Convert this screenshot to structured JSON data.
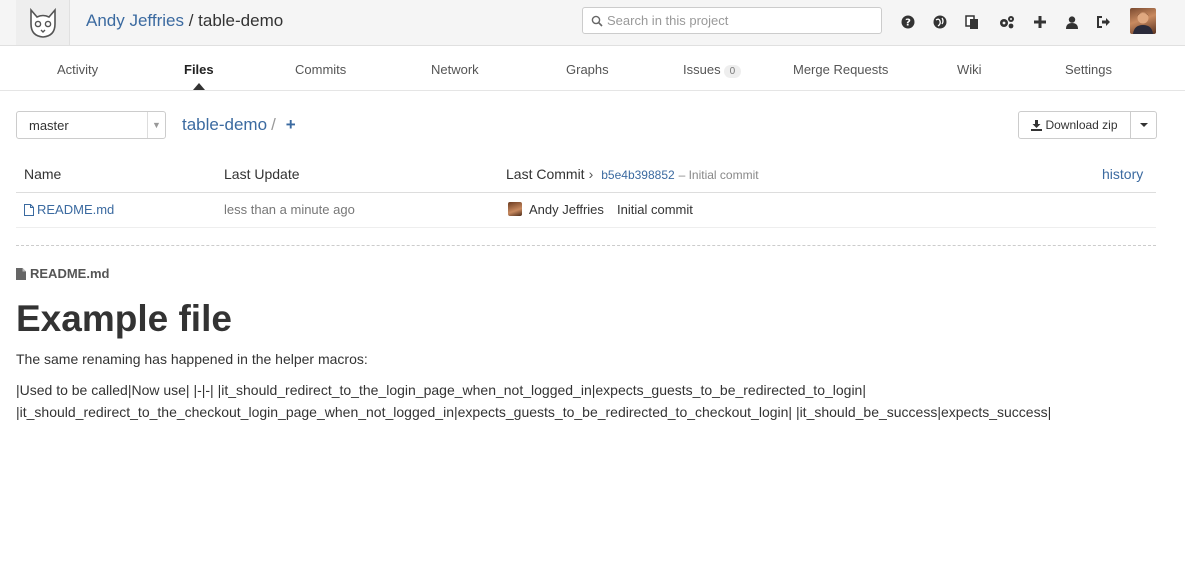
{
  "header": {
    "owner": "Andy Jeffries",
    "separator": " / ",
    "project": "table-demo",
    "search_placeholder": "Search in this project",
    "icons": [
      "help-icon",
      "globe-icon",
      "snippets-icon",
      "admin-gear-icon",
      "new-project-icon",
      "profile-icon",
      "logout-icon"
    ]
  },
  "nav": {
    "tabs": [
      {
        "label": "Activity"
      },
      {
        "label": "Files"
      },
      {
        "label": "Commits"
      },
      {
        "label": "Network"
      },
      {
        "label": "Graphs"
      },
      {
        "label": "Issues",
        "badge": "0"
      },
      {
        "label": "Merge Requests"
      },
      {
        "label": "Wiki"
      },
      {
        "label": "Settings"
      }
    ],
    "active": "Files"
  },
  "toolbar": {
    "branch": "master",
    "path_root": "table-demo",
    "path_sep": "/",
    "add_symbol": "+",
    "download_label": "Download zip"
  },
  "files": {
    "headers": {
      "name": "Name",
      "last_update": "Last Update",
      "last_commit": "Last Commit",
      "commit_sha": "b5e4b398852",
      "commit_msg": "– Initial commit",
      "history": "history"
    },
    "rows": [
      {
        "name": "README.md",
        "updated": "less than a minute ago",
        "author": "Andy Jeffries",
        "message": "Initial commit"
      }
    ]
  },
  "readme": {
    "filename": "README.md",
    "heading": "Example file",
    "intro": "The same renaming has happened in the helper macros:",
    "line1": "|Used to be called|Now use| |-|-| |it_should_redirect_to_the_login_page_when_not_logged_in|expects_guests_to_be_redirected_to_login|",
    "line2": "|it_should_redirect_to_the_checkout_login_page_when_not_logged_in|expects_guests_to_be_redirected_to_checkout_login| |it_should_be_success|expects_success|"
  },
  "colors": {
    "link": "#3b6aa0",
    "header_bg": "#f5f5f5"
  }
}
